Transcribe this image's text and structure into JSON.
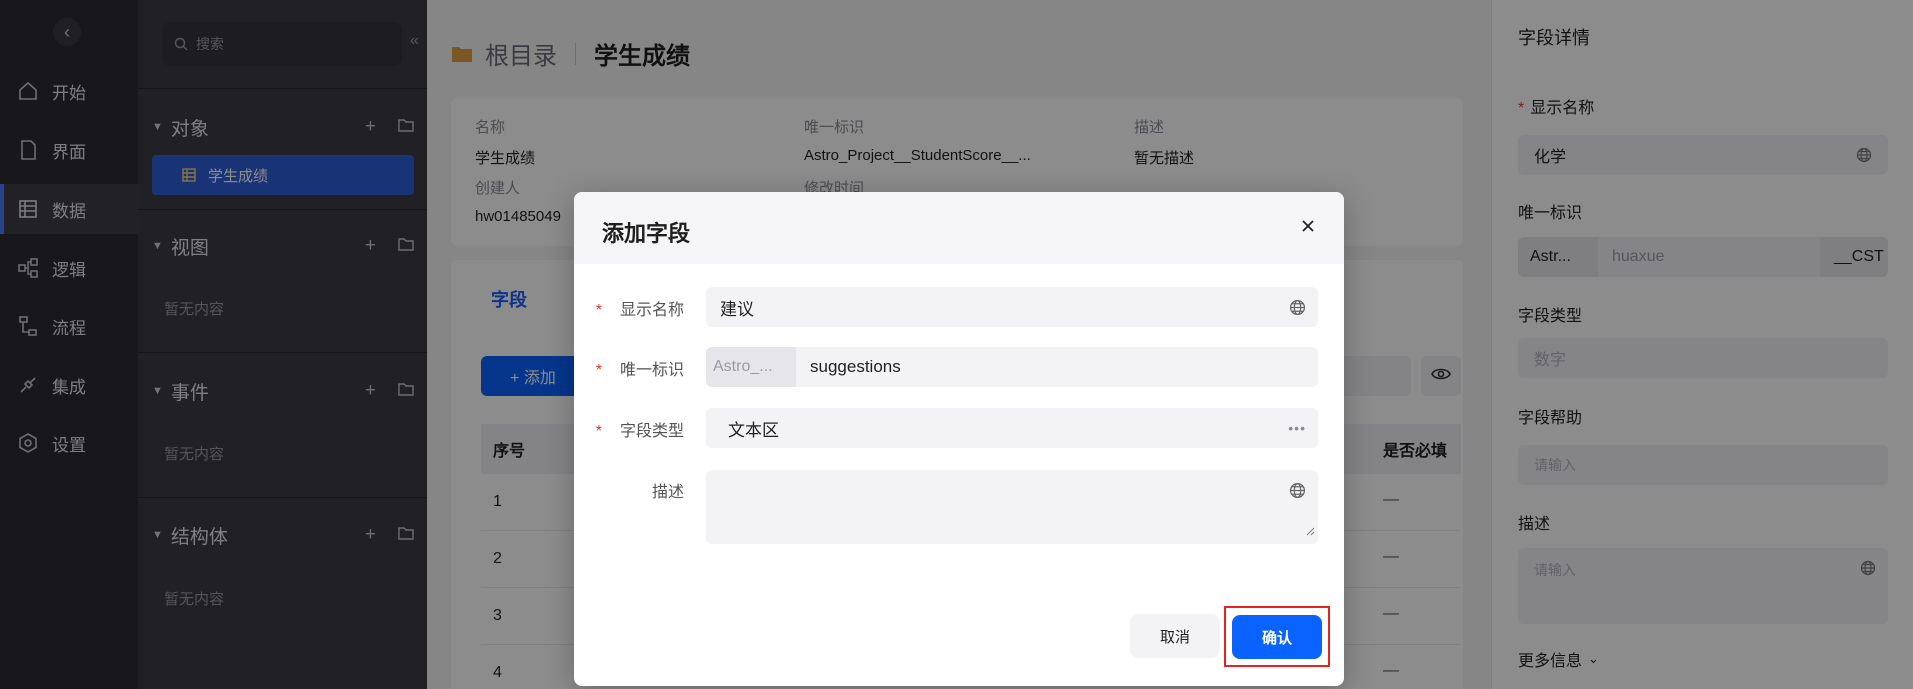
{
  "rail": {
    "items": [
      {
        "label": "开始",
        "icon": "home-icon"
      },
      {
        "label": "界面",
        "icon": "page-icon"
      },
      {
        "label": "数据",
        "icon": "table-icon"
      },
      {
        "label": "逻辑",
        "icon": "logic-icon"
      },
      {
        "label": "流程",
        "icon": "flow-icon"
      },
      {
        "label": "集成",
        "icon": "plug-icon"
      },
      {
        "label": "设置",
        "icon": "settings-icon"
      }
    ],
    "active": "数据"
  },
  "sidebar": {
    "search_placeholder": "搜索",
    "sections": [
      {
        "title": "对象",
        "items": [
          "学生成绩"
        ],
        "empty": ""
      },
      {
        "title": "视图",
        "items": [],
        "empty": "暂无内容"
      },
      {
        "title": "事件",
        "items": [],
        "empty": "暂无内容"
      },
      {
        "title": "结构体",
        "items": [],
        "empty": "暂无内容"
      }
    ]
  },
  "main": {
    "breadcrumb_root": "根目录",
    "breadcrumb_current": "学生成绩",
    "info": {
      "name_label": "名称",
      "name_value": "学生成绩",
      "uid_label": "唯一标识",
      "uid_value": "Astro_Project__StudentScore__...",
      "desc_label": "描述",
      "desc_value": "暂无描述",
      "creator_label": "创建人",
      "creator_value": "hw01485049",
      "modified_label": "修改时间"
    },
    "tab_label": "字段",
    "add_label": "+ 添加",
    "table": {
      "col_no": "序号",
      "col_required": "是否必填",
      "rows": [
        {
          "no": "1",
          "required": "—"
        },
        {
          "no": "2",
          "required": "—"
        },
        {
          "no": "3",
          "required": "—"
        },
        {
          "no": "4",
          "required": "—"
        }
      ]
    }
  },
  "panel": {
    "title": "字段详情",
    "display_name_label": "显示名称",
    "display_name_value": "化学",
    "uid_label": "唯一标识",
    "uid_prefix": "Astr...",
    "uid_value": "huaxue",
    "uid_suffix": "__CST",
    "type_label": "字段类型",
    "type_value": "数字",
    "help_label": "字段帮助",
    "help_placeholder": "请输入",
    "desc_label": "描述",
    "desc_placeholder": "请输入",
    "more_label": "更多信息"
  },
  "dialog": {
    "title": "添加字段",
    "display_name_label": "显示名称",
    "display_name_value": "建议",
    "uid_label": "唯一标识",
    "uid_prefix": "Astro_...",
    "uid_value": "suggestions",
    "type_label": "字段类型",
    "type_value": "文本区",
    "desc_label": "描述",
    "desc_value": "",
    "cancel_label": "取消",
    "confirm_label": "确认"
  },
  "colors": {
    "primary": "#0b63ff",
    "highlight_box": "#e8231f",
    "required_star": "#e5342b"
  }
}
